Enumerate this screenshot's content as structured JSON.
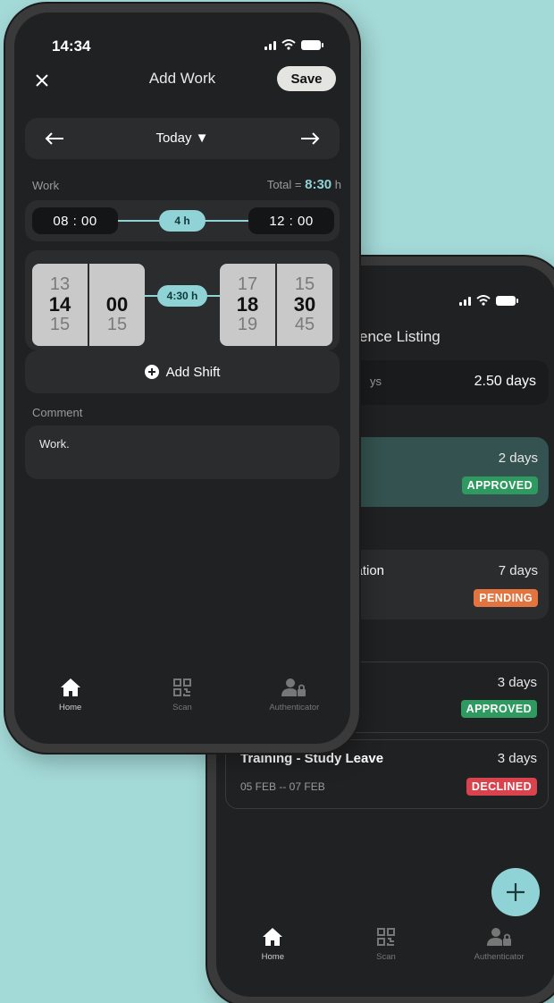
{
  "back_screen": {
    "status_bar": {},
    "title": "ence Listing",
    "summary": {
      "label": "ys",
      "value": "2.50 days"
    },
    "items": [
      {
        "duration": "2 days",
        "status": "APPROVED",
        "status_color": "#2e9a5f"
      },
      {
        "title": "cation",
        "duration": "7 days",
        "status": "PENDING",
        "status_color": "#e3743f"
      },
      {
        "duration": "3 days",
        "status": "APPROVED",
        "status_color": "#2e9a5f"
      },
      {
        "title": "Training - Study Leave",
        "dates": "05 FEB -- 07 FEB",
        "duration": "3 days",
        "status": "DECLINED",
        "status_color": "#d9434e"
      }
    ],
    "fab_icon": "plus-icon",
    "tabs": [
      {
        "label": "Home",
        "icon": "home-icon"
      },
      {
        "label": "Scan",
        "icon": "qr-icon"
      },
      {
        "label": "Authenticator",
        "icon": "user-lock-icon"
      }
    ]
  },
  "front_screen": {
    "status_bar": {
      "time": "14:34"
    },
    "header": {
      "title": "Add Work",
      "save_label": "Save",
      "close_icon": "close-icon"
    },
    "date_nav": {
      "label": "Today ▼",
      "prev_icon": "arrow-left-icon",
      "next_icon": "arrow-right-icon"
    },
    "work": {
      "label": "Work",
      "total_label": "Total =",
      "total_value": "8:30",
      "total_unit": "h",
      "shift1": {
        "start": "08 : 00",
        "duration": "4 h",
        "end": "12 : 00"
      },
      "shift2": {
        "start_hour": [
          "13",
          "14",
          "15"
        ],
        "start_min": [
          "00",
          "15"
        ],
        "duration": "4:30 h",
        "end_hour": [
          "17",
          "18",
          "19"
        ],
        "end_min": [
          "15",
          "30",
          "45"
        ]
      }
    },
    "add_shift_label": "Add Shift",
    "comment": {
      "label": "Comment",
      "value": "Work."
    },
    "tabs": [
      {
        "label": "Home",
        "icon": "home-icon"
      },
      {
        "label": "Scan",
        "icon": "qr-icon"
      },
      {
        "label": "Authenticator",
        "icon": "user-lock-icon"
      }
    ],
    "accent_color": "#8fd3d6"
  }
}
